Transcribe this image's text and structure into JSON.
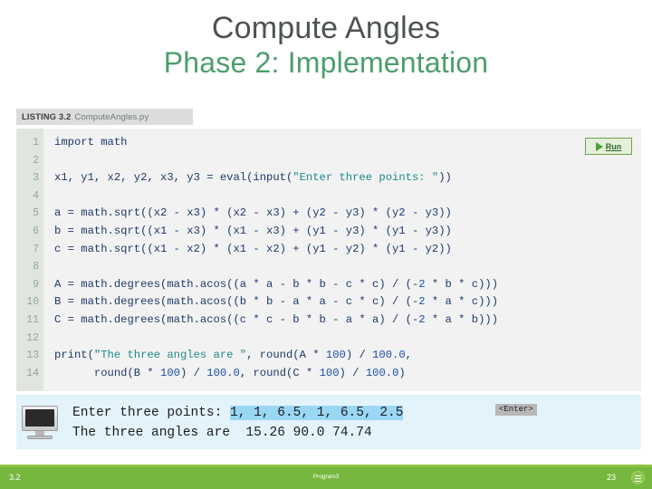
{
  "slide": {
    "title": "Compute Angles",
    "subtitle": "Phase 2: Implementation"
  },
  "listing": {
    "label": "LISTING 3.2",
    "filename": "ComputeAngles.py"
  },
  "run_button": {
    "label": "Run",
    "icon": "play-icon"
  },
  "code": {
    "line_numbers": [
      "1",
      "2",
      "3",
      "4",
      "5",
      "6",
      "7",
      "8",
      "9",
      "10",
      "11",
      "12",
      "13",
      "14"
    ],
    "lines": [
      "import math",
      "",
      "x1, y1, x2, y2, x3, y3 = eval(input(\"Enter three points: \"))",
      "",
      "a = math.sqrt((x2 - x3) * (x2 - x3) + (y2 - y3) * (y2 - y3))",
      "b = math.sqrt((x1 - x3) * (x1 - x3) + (y1 - y3) * (y1 - y3))",
      "c = math.sqrt((x1 - x2) * (x1 - x2) + (y1 - y2) * (y1 - y2))",
      "",
      "A = math.degrees(math.acos((a * a - b * b - c * c) / (-2 * b * c)))",
      "B = math.degrees(math.acos((b * b - a * a - c * c) / (-2 * a * c)))",
      "C = math.degrees(math.acos((c * c - b * b - a * a) / (-2 * a * b)))",
      "",
      "print(\"The three angles are \", round(A * 100) / 100.0,",
      "      round(B * 100) / 100.0, round(C * 100) / 100.0)"
    ]
  },
  "console": {
    "prompt_line_prefix": "Enter three points: ",
    "user_input": "1, 1, 6.5, 1, 6.5, 2.5",
    "output_line": "The three angles are  15.26 90.0 74.74",
    "enter_badge": "<Enter>",
    "icon": "monitor-icon"
  },
  "footer": {
    "left": "3.2",
    "center": "Program3",
    "right": "23",
    "logo": "menu-logo-icon"
  },
  "colors": {
    "title": "#4d5351",
    "subtitle": "#4d9e6a",
    "footer_bg": "#76b83f",
    "footer_accent": "#8dc63f",
    "code_bg": "#f2f2f2",
    "gutter_bg": "#dfe6e0",
    "console_bg": "#e3f3fb",
    "input_highlight": "#9ad7f5",
    "code_text": "#1e3a6b",
    "string_token": "#1a8a8a",
    "number_token": "#1e4fa8"
  }
}
